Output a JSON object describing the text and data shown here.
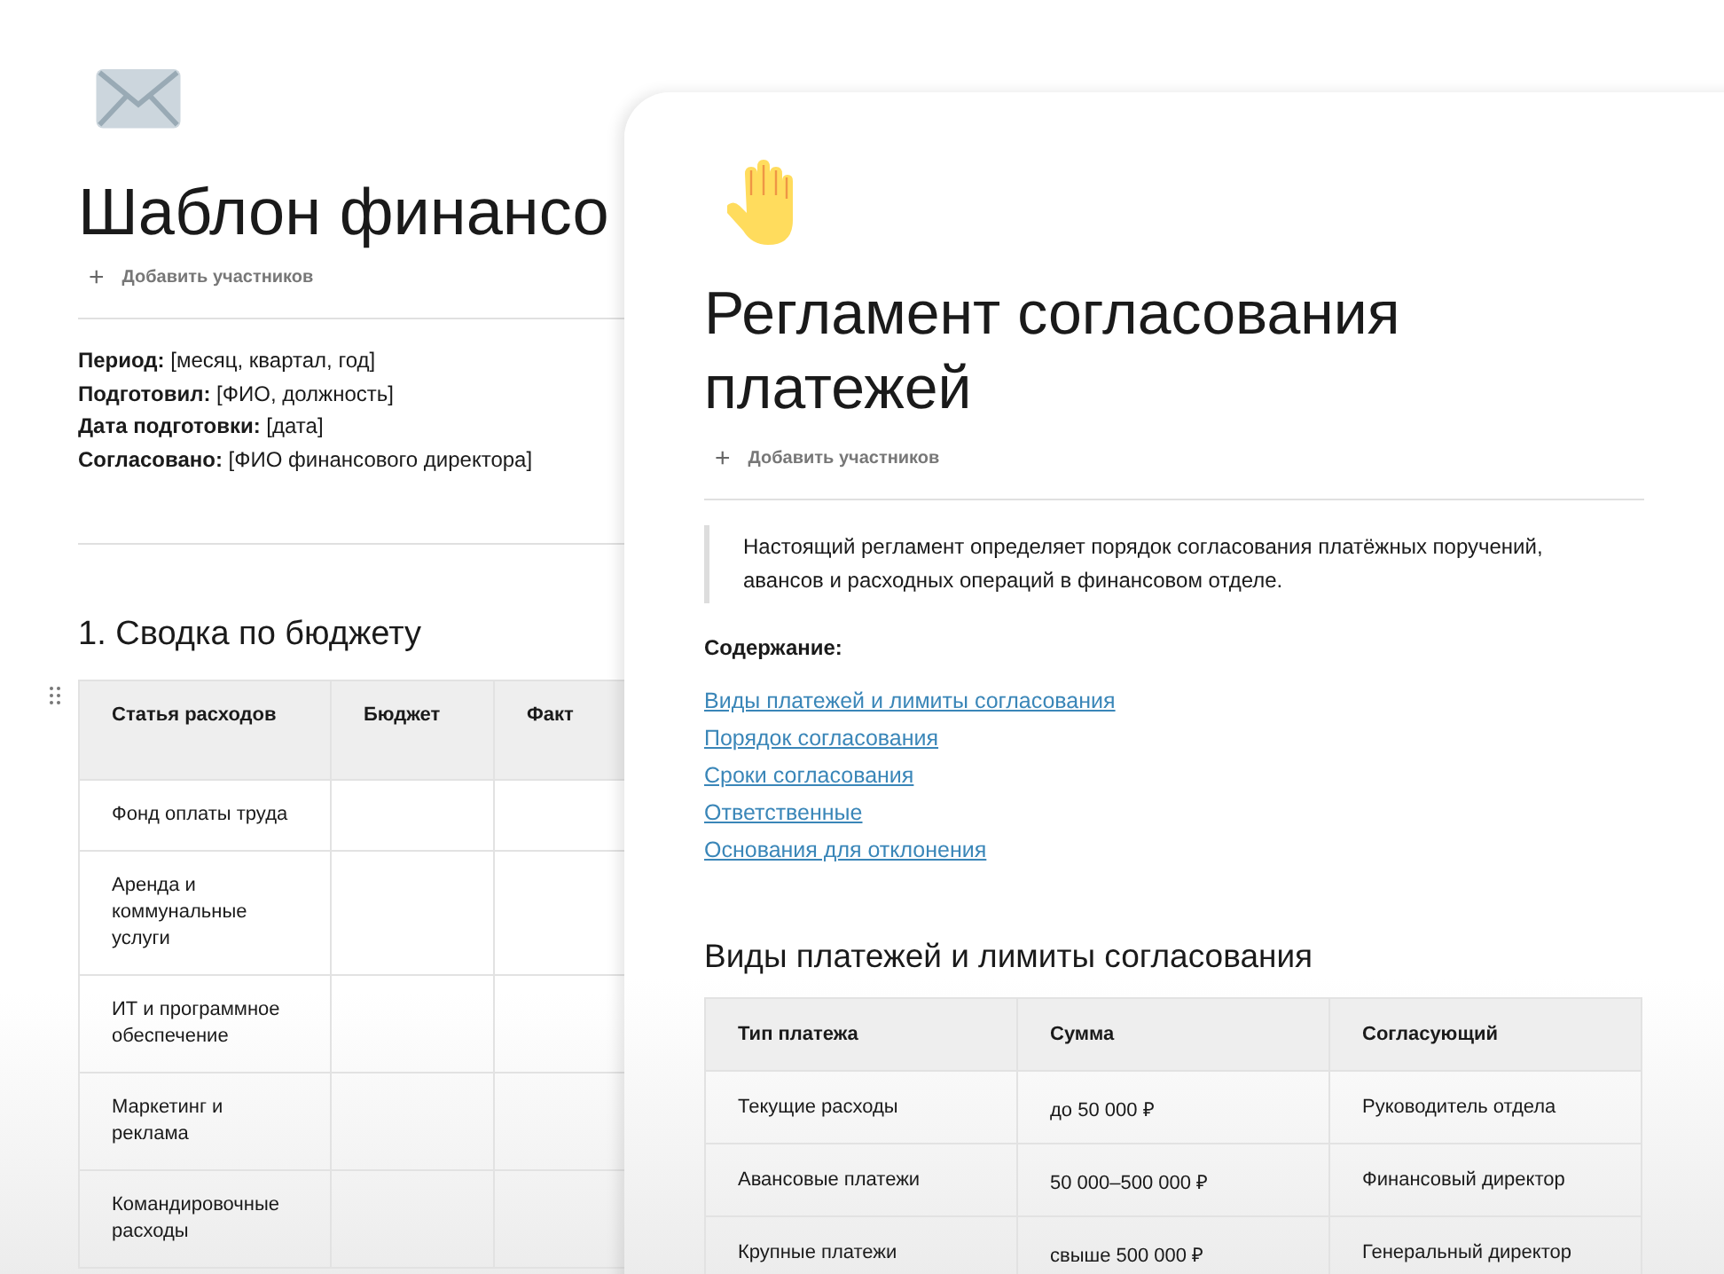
{
  "back_document": {
    "title": "Шаблон финансо",
    "add_participants": {
      "icon": "+",
      "label": "Добавить участников"
    },
    "meta_lines": [
      "**Период:** [месяц, квартал, год]",
      "**Подготовил:** [ФИО, должность]",
      "**Дата подготовки:** [дата]",
      "**Согласовано:** [ФИО финансового директора]"
    ],
    "section_heading": "1. Сводка по бюджету",
    "table": {
      "columns": [
        "Статья расходов",
        "Бюджет",
        "Факт"
      ],
      "rows": [
        [
          "Фонд оплаты труда",
          "",
          ""
        ],
        [
          "Аренда и коммунальные услуги",
          "",
          ""
        ],
        [
          "ИТ и программное обеспечение",
          "",
          ""
        ],
        [
          "Маркетинг и реклама",
          "",
          ""
        ],
        [
          "Командировочные расходы",
          "",
          ""
        ]
      ]
    }
  },
  "front_document": {
    "title": "Регламент согласования платежей",
    "add_participants": {
      "icon": "+",
      "label": "Добавить участников"
    },
    "quote": "Настоящий регламент определяет порядок согласования платёжных поручений, авансов и расходных операций в финансовом отделе.",
    "contents_heading": "Содержание:",
    "contents_links": [
      "Виды платежей и лимиты согласования",
      "Порядок согласования",
      "Сроки согласования",
      "Ответственные",
      "Основания для отклонения"
    ],
    "section_heading": "Виды платежей и лимиты согласования",
    "table": {
      "columns": [
        "Тип платежа",
        "Сумма",
        "Согласующий"
      ],
      "rows": [
        [
          "Текущие расходы",
          "до 50 000 ₽",
          "Руководитель отдела"
        ],
        [
          "Авансовые платежи",
          "50 000–500 000 ₽",
          "Финансовый директор"
        ],
        [
          "Крупные платежи",
          "свыше 500 000 ₽",
          "Генеральный директор"
        ]
      ]
    }
  }
}
